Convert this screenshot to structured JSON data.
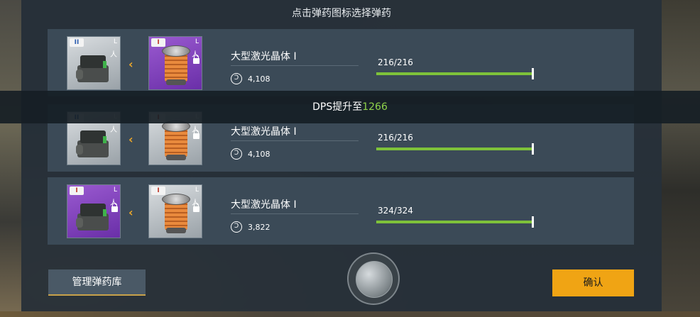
{
  "header": {
    "hint": "点击弹药图标选择弹药"
  },
  "rows": [
    {
      "slot1": {
        "tier": "II",
        "size": "L",
        "locked": false
      },
      "slot2": {
        "tier": "I",
        "size": "L",
        "locked": true
      },
      "name": "大型激光晶体 I",
      "cost": "4,108",
      "ammo": "216/216",
      "fill": 1.0
    },
    {
      "slot1": {
        "tier": "II",
        "size": "L",
        "locked": false
      },
      "slot2": {
        "tier": "I",
        "size": "L",
        "locked": true
      },
      "name": "大型激光晶体 I",
      "cost": "4,108",
      "ammo": "216/216",
      "fill": 1.0
    },
    {
      "slot1": {
        "tier": "I",
        "size": "L",
        "locked": true
      },
      "slot2": {
        "tier": "I",
        "size": "L",
        "locked": true
      },
      "name": "大型激光晶体 I",
      "cost": "3,822",
      "ammo": "324/324",
      "fill": 1.0
    }
  ],
  "dps": {
    "prefix": "DPS提升至",
    "value": "1266"
  },
  "buttons": {
    "manage": "管理弹药库",
    "confirm": "确认"
  },
  "icons": {
    "swap": "chevron-left-icon",
    "cost": "credit-icon",
    "crew": "person-icon",
    "lock": "lock-icon"
  },
  "colors": {
    "accent": "#f0a414",
    "bar": "#7ec23a",
    "dps_value": "#8fd24a"
  }
}
